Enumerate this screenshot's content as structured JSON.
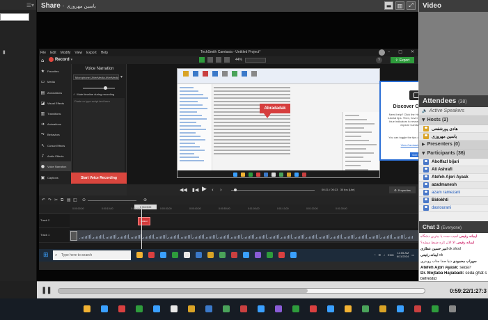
{
  "share": {
    "title": "Share",
    "separator": "-",
    "presenter": "یاسین مهروزی"
  },
  "video": {
    "title": "Video"
  },
  "attendees": {
    "title": "Attendees",
    "count": "(38)",
    "active_speakers": "Active Speakers",
    "hosts_label": "Hosts (2)",
    "hosts": [
      "هادی پورشفعی",
      "یاسین مهروزی"
    ],
    "presenters_label": "Presenters (0)",
    "participants_label": "Participants (36)",
    "participants": [
      "Abolfazl bijari",
      "Ali Ashrafi",
      "Atefeh Ajori Ayask",
      "azadmanesh",
      "azam ramezani",
      "Bidokhti",
      "dastourani"
    ]
  },
  "chat": {
    "title": "Chat 3",
    "scope": "(Everyone)",
    "messages": [
      {
        "who": "ایمانه رفیعی",
        "text": "اجیب ست یا بیترین دشگاه",
        "style": "pink"
      },
      {
        "who": "ایمانه رفیعی",
        "text": "الا الان ثاره ضبط ميشه؟",
        "style": "pink"
      },
      {
        "who": "امیر حسین عطاری",
        "text": "ok shod",
        "style": "normal"
      },
      {
        "who": "ایمانه رفیعی",
        "text": "ok",
        "style": "normal"
      },
      {
        "who": "سهراب محمودی",
        "text": "دنیا صدا جناب رویدری",
        "style": "normal"
      },
      {
        "who": "Atefeh Ajori Ayask:",
        "text": "seda?",
        "style": "big"
      },
      {
        "who": "Dr. Mojtaba Hajiabadi:",
        "text": "seda ghat s",
        "style": "big"
      },
      {
        "who": "",
        "text": "befrestid",
        "style": "big"
      },
      {
        "who": "",
        "text": "mezginejad is typing...",
        "style": "typing"
      }
    ]
  },
  "player": {
    "time": "0:59:22/1:27:3",
    "progress": 0.68
  },
  "camtasia": {
    "menu": [
      "File",
      "Edit",
      "Modify",
      "View",
      "Export",
      "Help"
    ],
    "title": "TechSmith Camtasia - Untitled Project*",
    "record_label": "Record",
    "zoom": "44%",
    "export_label": "Export",
    "sidebar": [
      {
        "icon": "★",
        "label": "Favorites",
        "name": "sidebar-item-favorites",
        "icon_name": "star-icon"
      },
      {
        "icon": "▭",
        "label": "Media",
        "name": "sidebar-item-media",
        "icon_name": "media-icon"
      },
      {
        "icon": "▤",
        "label": "Annotations",
        "name": "sidebar-item-annotations",
        "icon_name": "annotations-icon"
      },
      {
        "icon": "◪",
        "label": "Visual Effects",
        "name": "sidebar-item-visual-effects",
        "icon_name": "visual-effects-icon"
      },
      {
        "icon": "▥",
        "label": "Transitions",
        "name": "sidebar-item-transitions",
        "icon_name": "transitions-icon"
      },
      {
        "icon": "➔",
        "label": "Animations",
        "name": "sidebar-item-animations",
        "icon_name": "animations-icon"
      },
      {
        "icon": "↷",
        "label": "Behaviors",
        "name": "sidebar-item-behaviors",
        "icon_name": "behaviors-icon"
      },
      {
        "icon": "↖",
        "label": "Cursor Effects",
        "name": "sidebar-item-cursor-effects",
        "icon_name": "cursor-icon"
      },
      {
        "icon": "♪",
        "label": "Audio Effects",
        "name": "sidebar-item-audio-effects",
        "icon_name": "audio-icon"
      },
      {
        "icon": "●",
        "label": "Voice Narration",
        "name": "sidebar-item-voice-narration",
        "icon_name": "microphone-icon"
      },
      {
        "icon": "▣",
        "label": "Captions",
        "name": "sidebar-item-captions",
        "icon_name": "captions-icon"
      }
    ],
    "voice_narration": {
      "title": "Voice Narration",
      "mic": "Microphone (AVerMedia AVerMedia (R)) (R)",
      "mute_label": "Mute timeline during recording",
      "script_placeholder": "Paste or type script text here",
      "start_label": "Start Voice Recording"
    },
    "callout_text": "Abradadak",
    "discover": {
      "title": "Discover Camtasia",
      "text": "Need help? Click the Help button to turn on tutorial tips. Then, hover your cursor over the blue indicators to reveal helpful tips as you explore Camtasia Editor.",
      "text2": "You can toggle the tips on or off at any time.",
      "link": "View Camtasia Tutorials",
      "button": "Got it"
    },
    "playback_time": "00:21 / 00:23",
    "fps": "30 fps [Lite]",
    "properties_label": "Properties",
    "playhead_time": "0:00:23;00",
    "ruler": [
      "0:00:00;00",
      "0:00:10;00",
      "0:00:20;00",
      "0:00:30;00",
      "0:00:40;00",
      "0:00:50;00",
      "0:01:00;00",
      "0:01:10;00",
      "0:01:20;00",
      "0:01:30;00"
    ],
    "tracks": [
      "Track 2",
      "Track 1"
    ],
    "clip_label": "Callout"
  },
  "windows": {
    "search_placeholder": "Type here to search",
    "lang": "ENG",
    "time": "11:55 AM",
    "date": "6/11/2024"
  },
  "colors": {
    "accent_green": "#2e9c3c",
    "record_red": "#e2473f",
    "discover_blue": "#2c6fd6"
  }
}
